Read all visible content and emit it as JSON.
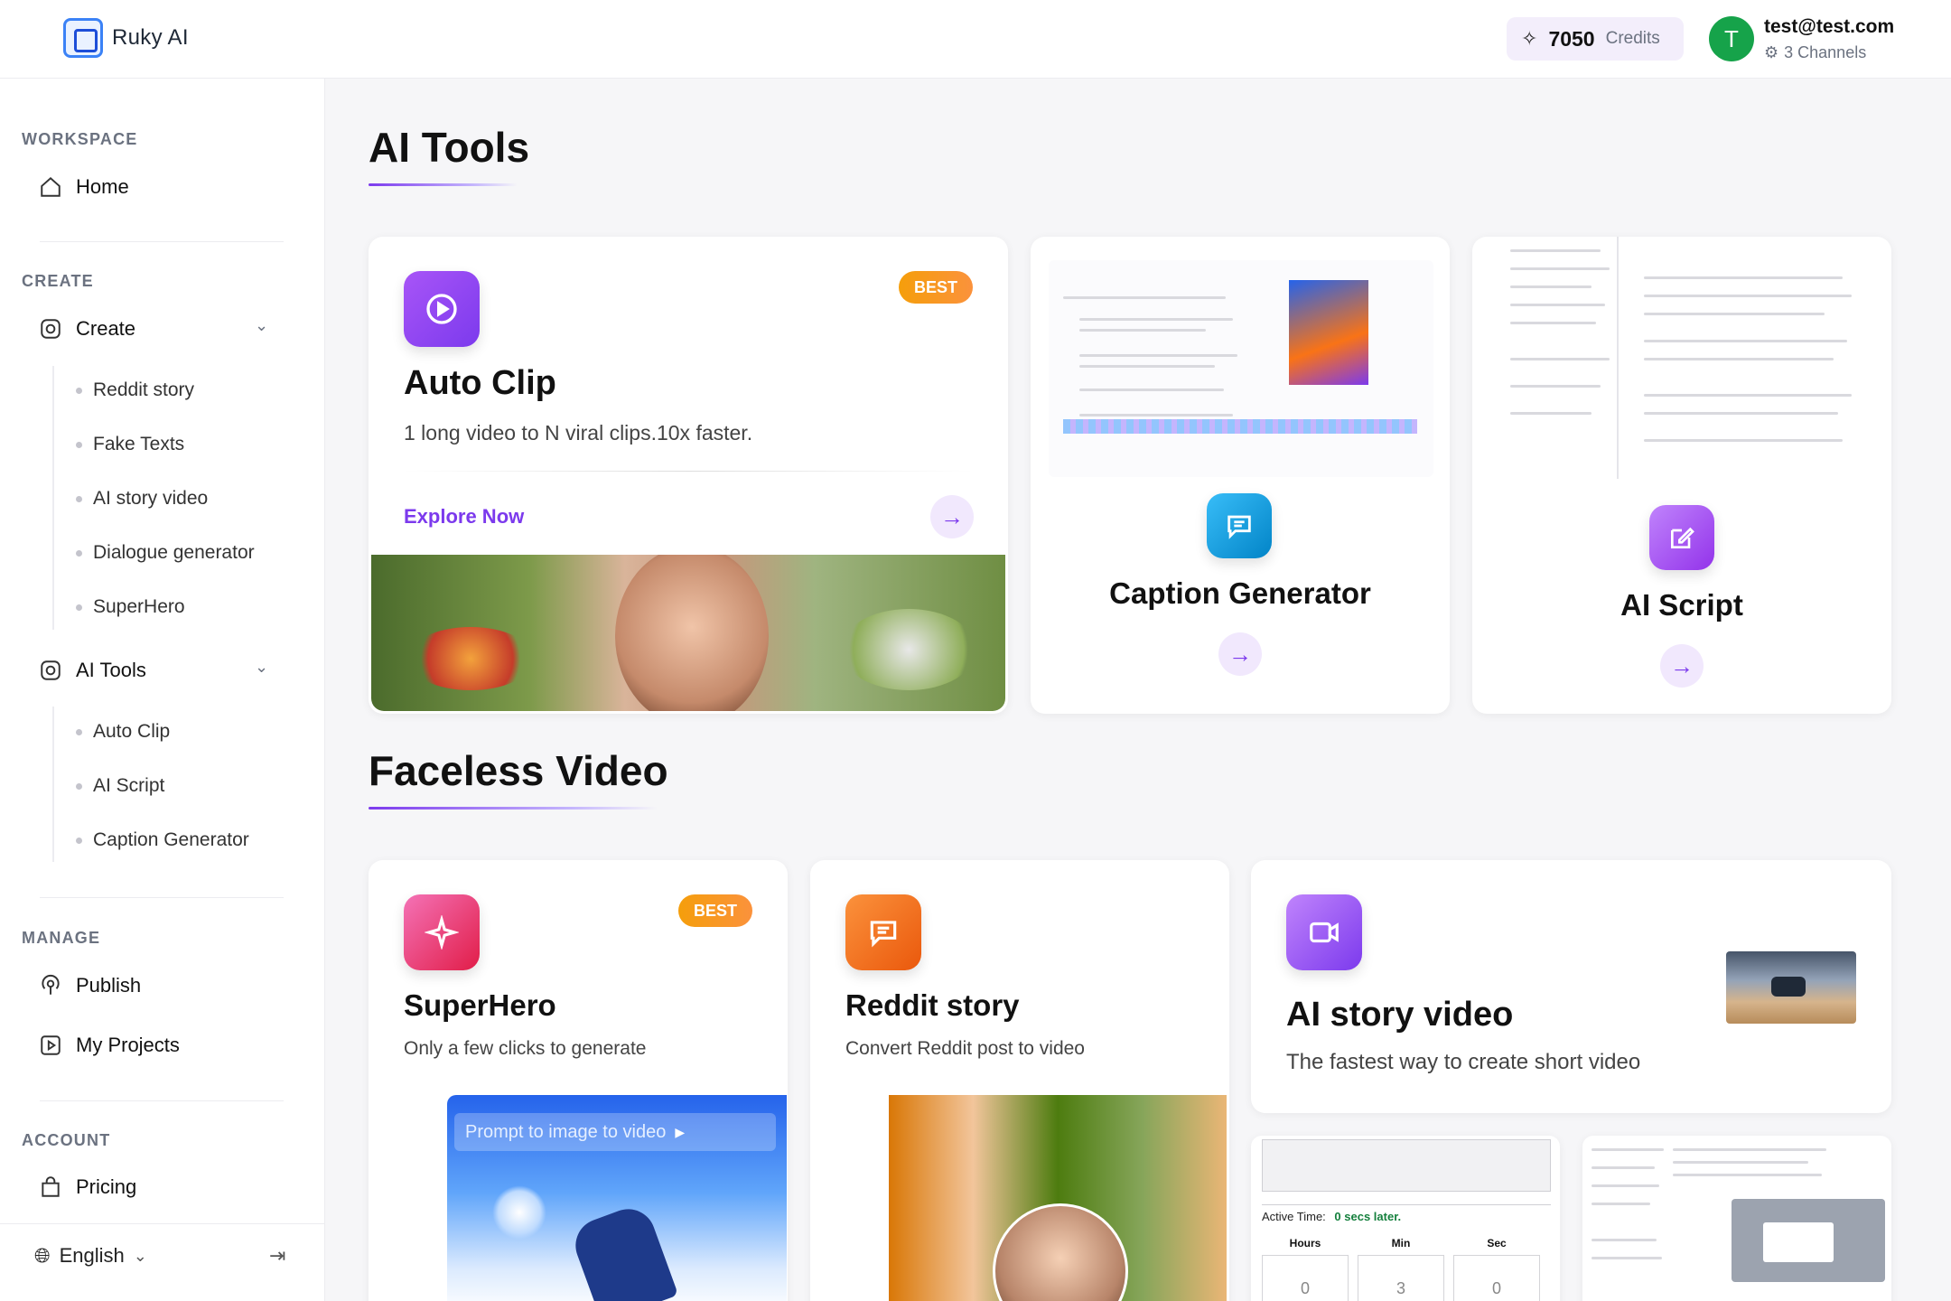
{
  "header": {
    "logo_text": "Ruky AI",
    "credits_value": "7050",
    "credits_label": "Credits",
    "avatar_letter": "T",
    "user_email": "test@test.com",
    "channels": "3 Channels"
  },
  "sidebar": {
    "workspace_label": "WORKSPACE",
    "home": "Home",
    "create_label": "CREATE",
    "create": "Create",
    "create_items": [
      "Reddit story",
      "Fake Texts",
      "AI story video",
      "Dialogue generator",
      "SuperHero"
    ],
    "ai_tools": "AI Tools",
    "ai_tools_items": [
      "Auto Clip",
      "AI Script",
      "Caption Generator"
    ],
    "manage_label": "MANAGE",
    "publish": "Publish",
    "my_projects": "My Projects",
    "account_label": "ACCOUNT",
    "pricing": "Pricing",
    "language": "English"
  },
  "main": {
    "ai_tools_title": "AI Tools",
    "faceless_title": "Faceless Video",
    "auto_clip": {
      "badge": "BEST",
      "title": "Auto Clip",
      "desc": "1 long video to N viral clips.10x faster.",
      "cta": "Explore Now"
    },
    "caption_generator": {
      "title": "Caption Generator"
    },
    "ai_script": {
      "title": "AI Script"
    },
    "superhero": {
      "badge": "BEST",
      "title": "SuperHero",
      "desc": "Only a few clicks to generate",
      "preview_label": "Prompt to image to video"
    },
    "reddit_story": {
      "title": "Reddit story",
      "desc": "Convert Reddit post to video"
    },
    "ai_story_video": {
      "title": "AI story video",
      "desc": "The fastest way to create short video"
    },
    "timer_preview": {
      "active_time_label": "Active Time:",
      "active_time_value": "0 secs later.",
      "hours": "Hours",
      "min": "Min",
      "sec": "Sec",
      "hours_val": "0",
      "min_val": "3",
      "sec_val": "0"
    }
  },
  "colors": {
    "accent": "#7c3aed",
    "badge": "#f59e0b",
    "avatar": "#16a34a"
  }
}
